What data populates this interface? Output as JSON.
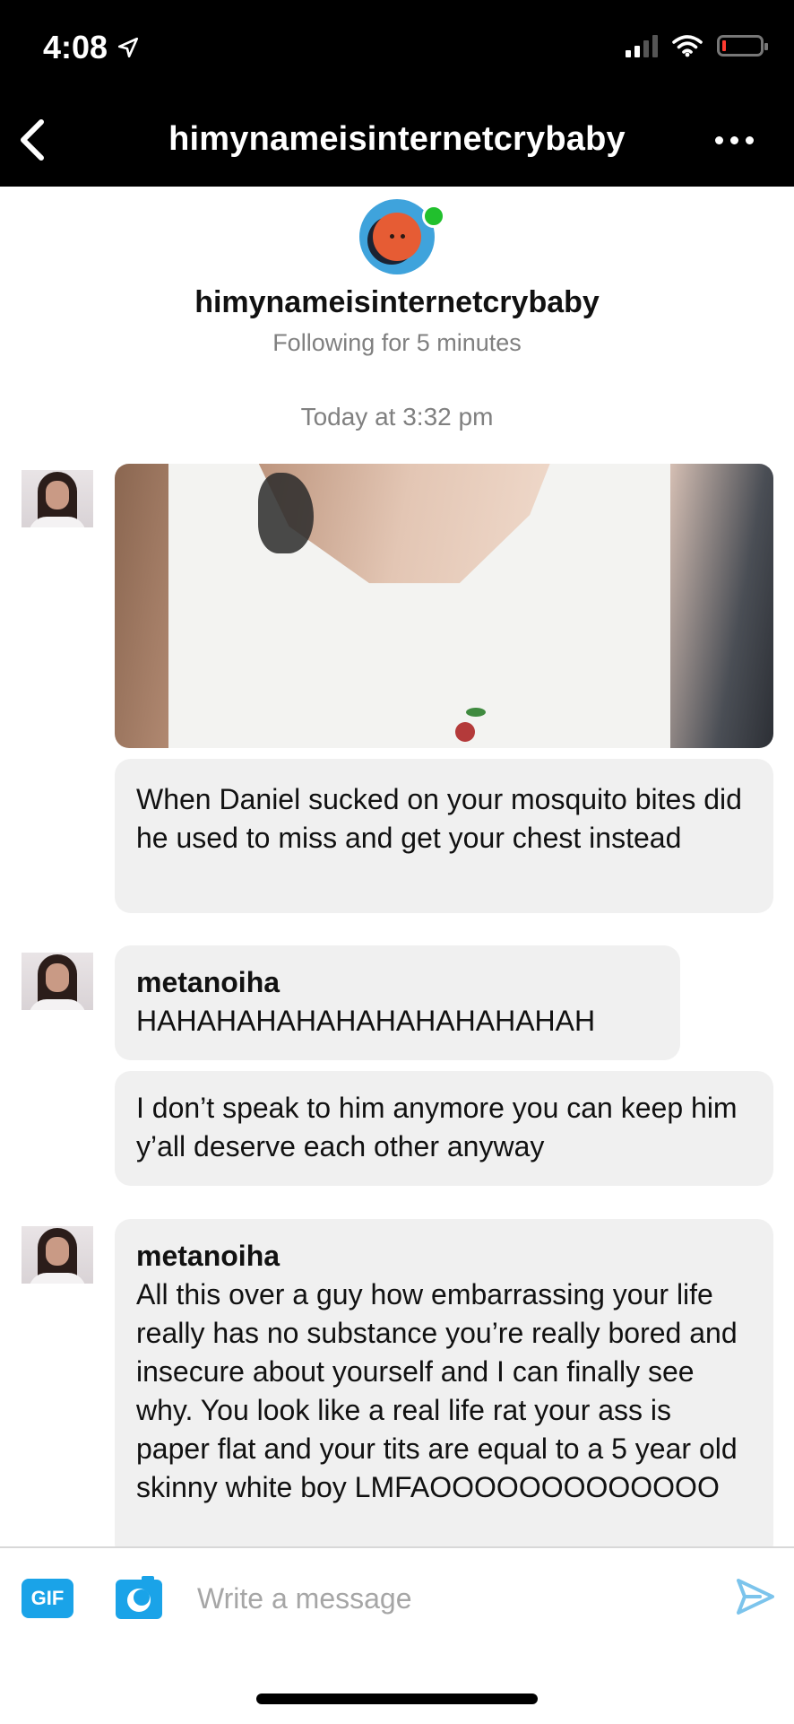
{
  "status_bar": {
    "time": "4:08",
    "location_icon": "location-arrow-icon",
    "signal_icon": "cellular-signal-icon",
    "wifi_icon": "wifi-icon",
    "battery_icon": "battery-low-icon",
    "battery_color": "#ff3b30"
  },
  "nav": {
    "back_icon": "chevron-left-icon",
    "title": "himynameisinternetcrybaby",
    "more_icon": "more-horizontal-icon"
  },
  "profile": {
    "name": "himynameisinternetcrybaby",
    "following": "Following for 5 minutes",
    "online_color": "#21c02d",
    "avatar_color": "#3fa3dc"
  },
  "conversation": {
    "timestamp": "Today at 3:32 pm",
    "messages": [
      {
        "type": "image",
        "sender": "",
        "text": ""
      },
      {
        "type": "text",
        "sender": "",
        "text": "When Daniel sucked on your mosquito bites did he used to miss and get your chest instead"
      },
      {
        "type": "text",
        "sender": "metanoiha",
        "text": "HAHAHAHAHAHAHAHAHAHAHAH"
      },
      {
        "type": "text",
        "sender": "",
        "text": "I don’t speak to him anymore you can keep him y’all deserve each other anyway"
      },
      {
        "type": "text",
        "sender": "metanoiha",
        "text": "All this over a guy how embarrassing your life really has no substance you’re really bored and insecure about yourself and I can finally see why. You look like a real life rat your ass is paper flat and your tits are equal to a 5 year old skinny white boy LMFAOOOOOOOOOOOOO"
      }
    ]
  },
  "composer": {
    "gif_label": "GIF",
    "camera_icon": "camera-icon",
    "placeholder": "Write a message",
    "value": "",
    "send_icon": "send-icon",
    "accent_color": "#1aa3e8"
  }
}
